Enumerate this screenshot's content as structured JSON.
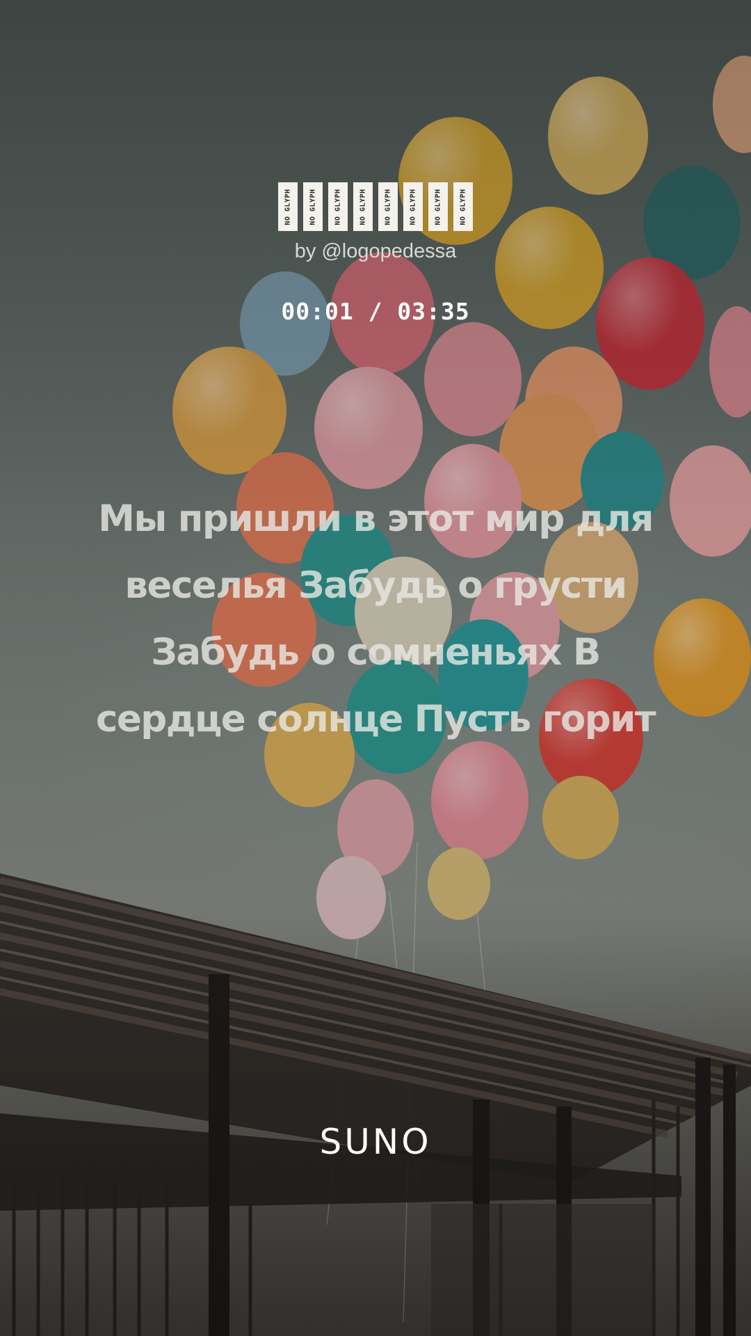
{
  "title": {
    "glyph_boxes": [
      "NO GLYPH",
      "NO GLYPH",
      "NO GLYPH",
      "NO GLYPH",
      "NO GLYPH",
      "NO GLYPH",
      "NO GLYPH",
      "NO GLYPH"
    ]
  },
  "artist": "by @logopedessa",
  "playback": {
    "time": "00:01 / 03:35"
  },
  "lyrics": {
    "lines": [
      "Мы пришли в этот мир для",
      "веселья Забудь о грусти",
      "Забудь о сомненьях В",
      "сердце солнце Пусть горит"
    ]
  },
  "brand": {
    "logo": "SUNO"
  },
  "colors": {
    "text_primary": "#ffffff",
    "lyrics_text": "#e8e8e4",
    "sky": "#7d8681"
  }
}
